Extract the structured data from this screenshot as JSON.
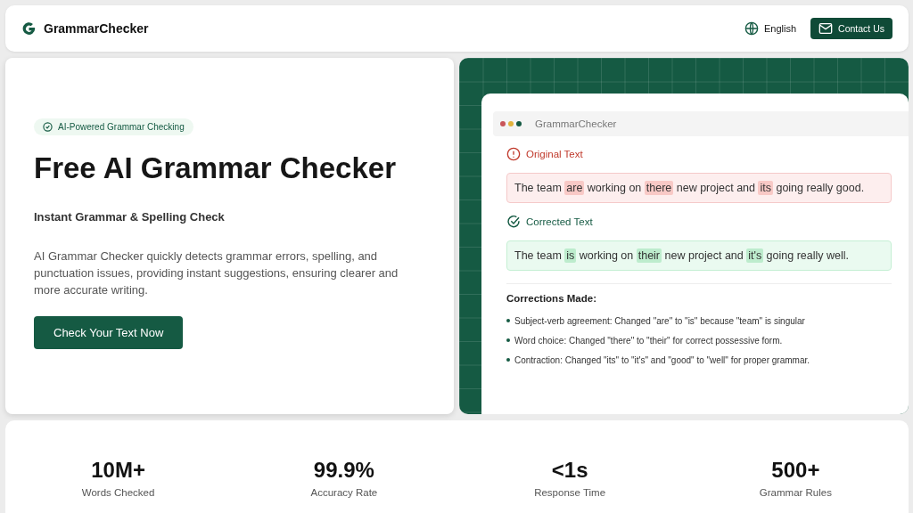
{
  "header": {
    "brand": "GrammarChecker",
    "language": "English",
    "contact": "Contact Us"
  },
  "hero": {
    "badge": "AI-Powered Grammar Checking",
    "title": "Free AI Grammar Checker",
    "subtitle": "Instant Grammar & Spelling Check",
    "description": "AI Grammar Checker quickly detects grammar errors, spelling, and punctuation issues, providing instant suggestions, ensuring clearer and more accurate writing.",
    "cta": "Check Your Text Now"
  },
  "demo": {
    "window_dots": [
      {
        "color": "#c9565a"
      },
      {
        "color": "#e2b33c"
      },
      {
        "color": "#155a43"
      }
    ],
    "app_title": "GrammarChecker",
    "original": {
      "label": "Original Text",
      "segments": [
        {
          "text": "The team ",
          "highlight": false
        },
        {
          "text": "are",
          "highlight": true
        },
        {
          "text": " working on ",
          "highlight": false
        },
        {
          "text": "there",
          "highlight": true
        },
        {
          "text": " new project and ",
          "highlight": false
        },
        {
          "text": "its",
          "highlight": true
        },
        {
          "text": " going really good.",
          "highlight": false
        }
      ]
    },
    "corrected": {
      "label": "Corrected Text",
      "segments": [
        {
          "text": "The team ",
          "highlight": false
        },
        {
          "text": "is",
          "highlight": true
        },
        {
          "text": " working on ",
          "highlight": false
        },
        {
          "text": "their",
          "highlight": true
        },
        {
          "text": " new project and ",
          "highlight": false
        },
        {
          "text": "it's",
          "highlight": true
        },
        {
          "text": " going really well.",
          "highlight": false
        }
      ]
    },
    "corrections_title": "Corrections Made:",
    "corrections": [
      "Subject-verb agreement: Changed \"are\" to \"is\" because \"team\" is singular",
      "Word choice: Changed \"there\" to \"their\" for correct possessive form.",
      "Contraction: Changed \"its\" to \"it's\" and \"good\" to \"well\" for proper grammar."
    ]
  },
  "stats": [
    {
      "value": "10M+",
      "label": "Words Checked"
    },
    {
      "value": "99.9%",
      "label": "Accuracy Rate"
    },
    {
      "value": "<1s",
      "label": "Response Time"
    },
    {
      "value": "500+",
      "label": "Grammar Rules"
    }
  ]
}
